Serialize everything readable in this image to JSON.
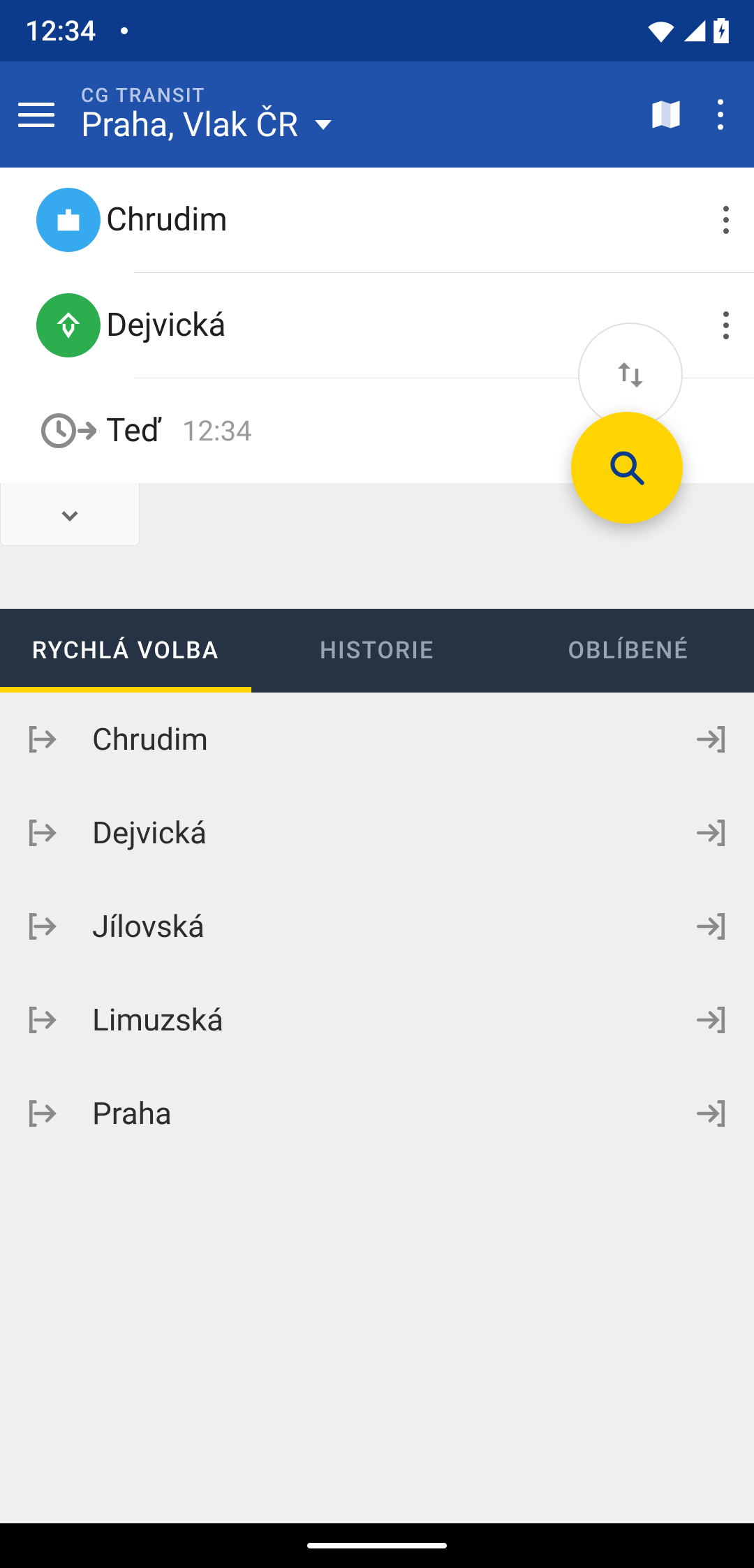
{
  "status": {
    "time": "12:34"
  },
  "appbar": {
    "subtitle": "CG TRANSIT",
    "title": "Praha, Vlak ČR"
  },
  "search": {
    "from": "Chrudim",
    "to": "Dejvická",
    "time_label": "Teď",
    "time_value": "12:34"
  },
  "tabs": {
    "quick": "RYCHLÁ VOLBA",
    "history": "HISTORIE",
    "favorites": "OBLÍBENÉ"
  },
  "quick": {
    "items": [
      {
        "label": "Chrudim"
      },
      {
        "label": "Dejvická"
      },
      {
        "label": "Jílovská"
      },
      {
        "label": "Limuzská"
      },
      {
        "label": "Praha"
      }
    ]
  }
}
